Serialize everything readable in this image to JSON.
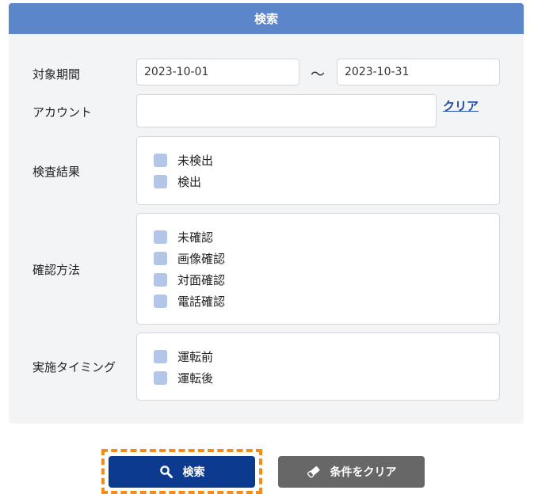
{
  "panel": {
    "title": "検索"
  },
  "period": {
    "label": "対象期間",
    "from": "2023-10-01",
    "separator": "～",
    "to": "2023-10-31"
  },
  "account": {
    "label": "アカウント",
    "value": "",
    "clear_link": "クリア"
  },
  "inspection_result": {
    "label": "検査結果",
    "options": [
      "未検出",
      "検出"
    ]
  },
  "confirmation_method": {
    "label": "確認方法",
    "options": [
      "未確認",
      "画像確認",
      "対面確認",
      "電話確認"
    ]
  },
  "timing": {
    "label": "実施タイミング",
    "options": [
      "運転前",
      "運転後"
    ]
  },
  "buttons": {
    "search": "検索",
    "clear": "条件をクリア"
  },
  "colors": {
    "header": "#5b86c9",
    "primary_button": "#0b3a8f",
    "secondary_button": "#676767",
    "checkbox": "#b3c6e8",
    "focus": "#f28c1a",
    "link": "#1f4aa8"
  },
  "icons": {
    "search_button": "search-icon",
    "clear_button": "eraser-icon"
  }
}
